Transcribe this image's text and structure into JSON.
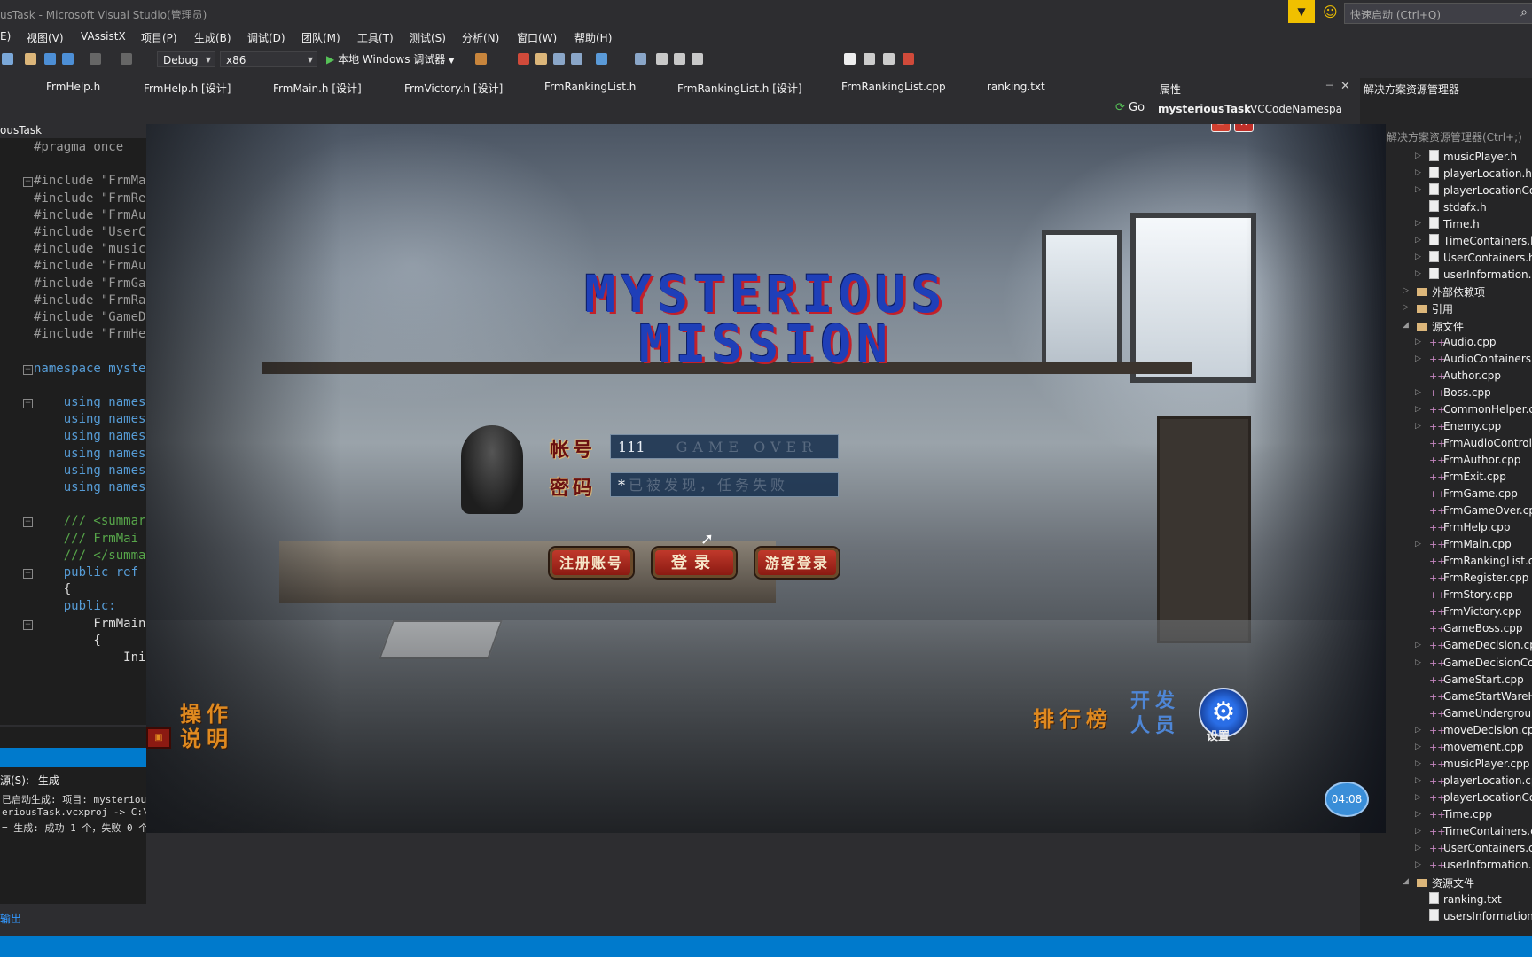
{
  "window": {
    "title": "usTask - Microsoft Visual Studio(管理员)"
  },
  "quick_launch": {
    "placeholder": "快速启动 (Ctrl+Q)"
  },
  "menu": [
    "E)",
    "视图(V)",
    "VAssistX",
    "项目(P)",
    "生成(B)",
    "调试(D)",
    "团队(M)",
    "工具(T)",
    "测试(S)",
    "分析(N)",
    "窗口(W)",
    "帮助(H)"
  ],
  "toolbar": {
    "config": "Debug",
    "platform": "x86",
    "run_label": "本地 Windows 调试器"
  },
  "doc_tabs": [
    "FrmHelp.h",
    "FrmHelp.h [设计]",
    "FrmMain.h [设计]",
    "FrmVictory.h [设计]",
    "FrmRankingList.h",
    "FrmRankingList.h [设计]",
    "FrmRankingList.cpp",
    "ranking.txt"
  ],
  "nav": {
    "go": "Go"
  },
  "editor": {
    "project": "ousTask",
    "lines": [
      {
        "t": "#pragma once",
        "c": "pp"
      },
      {
        "t": "",
        "c": ""
      },
      {
        "t": "#include \"FrmMa",
        "c": "pp"
      },
      {
        "t": "#include \"FrmRe",
        "c": "pp"
      },
      {
        "t": "#include \"FrmAu",
        "c": "pp"
      },
      {
        "t": "#include \"UserC",
        "c": "pp"
      },
      {
        "t": "#include \"music",
        "c": "pp"
      },
      {
        "t": "#include \"FrmAu",
        "c": "pp"
      },
      {
        "t": "#include \"FrmGa",
        "c": "pp"
      },
      {
        "t": "#include \"FrmRa",
        "c": "pp"
      },
      {
        "t": "#include \"GameD",
        "c": "pp"
      },
      {
        "t": "#include \"FrmHe",
        "c": "pp"
      },
      {
        "t": "",
        "c": ""
      },
      {
        "t": "namespace myste",
        "c": "kw"
      },
      {
        "t": "",
        "c": ""
      },
      {
        "t": "    using names",
        "c": "kw"
      },
      {
        "t": "    using names",
        "c": "kw"
      },
      {
        "t": "    using names",
        "c": "kw"
      },
      {
        "t": "    using names",
        "c": "kw"
      },
      {
        "t": "    using names",
        "c": "kw"
      },
      {
        "t": "    using names",
        "c": "kw"
      },
      {
        "t": "",
        "c": ""
      },
      {
        "t": "    /// <summar",
        "c": "cm"
      },
      {
        "t": "    /// FrmMai",
        "c": "cm"
      },
      {
        "t": "    /// </summa",
        "c": "cm"
      },
      {
        "t": "    public ref ",
        "c": "kw"
      },
      {
        "t": "    {",
        "c": ""
      },
      {
        "t": "    public:",
        "c": "kw"
      },
      {
        "t": "        FrmMain",
        "c": ""
      },
      {
        "t": "        {",
        "c": ""
      },
      {
        "t": "            Ini",
        "c": ""
      }
    ]
  },
  "output": {
    "source_label": "源(S):",
    "source_value": "生成",
    "lines": [
      "已启动生成: 项目: mysteriou",
      "eriousTask.vcxproj -> C:\\Use",
      "= 生成: 成功 1 个，失败 0 个"
    ],
    "tab": "输出"
  },
  "properties": {
    "title": "属性",
    "object": "mysteriousTask",
    "type": "VCCodeNamespa"
  },
  "solution": {
    "title": "解决方案资源管理器",
    "search": "解决方案资源管理器(Ctrl+;)",
    "items": [
      {
        "n": "musicPlayer.h",
        "k": "file",
        "a": true
      },
      {
        "n": "playerLocation.h",
        "k": "file",
        "a": true
      },
      {
        "n": "playerLocationCor",
        "k": "file",
        "a": true
      },
      {
        "n": "stdafx.h",
        "k": "file",
        "a": false
      },
      {
        "n": "Time.h",
        "k": "file",
        "a": true
      },
      {
        "n": "TimeContainers.h",
        "k": "file",
        "a": true
      },
      {
        "n": "UserContainers.h",
        "k": "file",
        "a": true
      },
      {
        "n": "userInformation.h",
        "k": "file",
        "a": true
      },
      {
        "n": "外部依赖项",
        "k": "folder",
        "a": true,
        "l": 0
      },
      {
        "n": "引用",
        "k": "folder",
        "a": true,
        "l": 0
      },
      {
        "n": "源文件",
        "k": "folder",
        "a": true,
        "l": 0
      },
      {
        "n": "Audio.cpp",
        "k": "cpp",
        "a": true
      },
      {
        "n": "AudioContainers.c",
        "k": "cpp",
        "a": true
      },
      {
        "n": "Author.cpp",
        "k": "cpp",
        "a": false
      },
      {
        "n": "Boss.cpp",
        "k": "cpp",
        "a": true
      },
      {
        "n": "CommonHelper.cp",
        "k": "cpp",
        "a": true
      },
      {
        "n": "Enemy.cpp",
        "k": "cpp",
        "a": true
      },
      {
        "n": "FrmAudioControl.c",
        "k": "cpp",
        "a": false
      },
      {
        "n": "FrmAuthor.cpp",
        "k": "cpp",
        "a": false
      },
      {
        "n": "FrmExit.cpp",
        "k": "cpp",
        "a": false
      },
      {
        "n": "FrmGame.cpp",
        "k": "cpp",
        "a": false
      },
      {
        "n": "FrmGameOver.cpp",
        "k": "cpp",
        "a": false
      },
      {
        "n": "FrmHelp.cpp",
        "k": "cpp",
        "a": false
      },
      {
        "n": "FrmMain.cpp",
        "k": "cpp",
        "a": true
      },
      {
        "n": "FrmRankingList.cp",
        "k": "cpp",
        "a": false
      },
      {
        "n": "FrmRegister.cpp",
        "k": "cpp",
        "a": false
      },
      {
        "n": "FrmStory.cpp",
        "k": "cpp",
        "a": false
      },
      {
        "n": "FrmVictory.cpp",
        "k": "cpp",
        "a": false
      },
      {
        "n": "GameBoss.cpp",
        "k": "cpp",
        "a": false
      },
      {
        "n": "GameDecision.cpp",
        "k": "cpp",
        "a": true
      },
      {
        "n": "GameDecisionCon",
        "k": "cpp",
        "a": true
      },
      {
        "n": "GameStart.cpp",
        "k": "cpp",
        "a": false
      },
      {
        "n": "GameStartWareHc",
        "k": "cpp",
        "a": false
      },
      {
        "n": "GameUndergroun",
        "k": "cpp",
        "a": false
      },
      {
        "n": "moveDecision.cpp",
        "k": "cpp",
        "a": true
      },
      {
        "n": "movement.cpp",
        "k": "cpp",
        "a": true
      },
      {
        "n": "musicPlayer.cpp",
        "k": "cpp",
        "a": true
      },
      {
        "n": "playerLocation.cp",
        "k": "cpp",
        "a": true
      },
      {
        "n": "playerLocationCor",
        "k": "cpp",
        "a": true
      },
      {
        "n": "Time.cpp",
        "k": "cpp",
        "a": true
      },
      {
        "n": "TimeContainers.cp",
        "k": "cpp",
        "a": true
      },
      {
        "n": "UserContainers.cp",
        "k": "cpp",
        "a": true
      },
      {
        "n": "userInformation.cp",
        "k": "cpp",
        "a": true
      },
      {
        "n": "资源文件",
        "k": "folder",
        "a": true,
        "l": 0
      },
      {
        "n": "ranking.txt",
        "k": "file",
        "a": false
      },
      {
        "n": "usersInformation.t",
        "k": "file",
        "a": false
      }
    ]
  },
  "game": {
    "title_line1": "MYSTERIOUS",
    "title_line2": "MISSION",
    "account_label": "帐号",
    "account_value": "111",
    "password_label": "密码",
    "password_value": "*",
    "password_hint": "已被发现，任务失败",
    "watermark": "GAME OVER",
    "register_btn": "注册账号",
    "login_btn": "登录",
    "guest_btn": "游客登录",
    "help_line1": "操作",
    "help_line2": "说明",
    "ranking": "排行榜",
    "dev_line1": "开发",
    "dev_line2": "人员",
    "settings": "设置"
  },
  "recorder": {
    "time": "04:08"
  }
}
